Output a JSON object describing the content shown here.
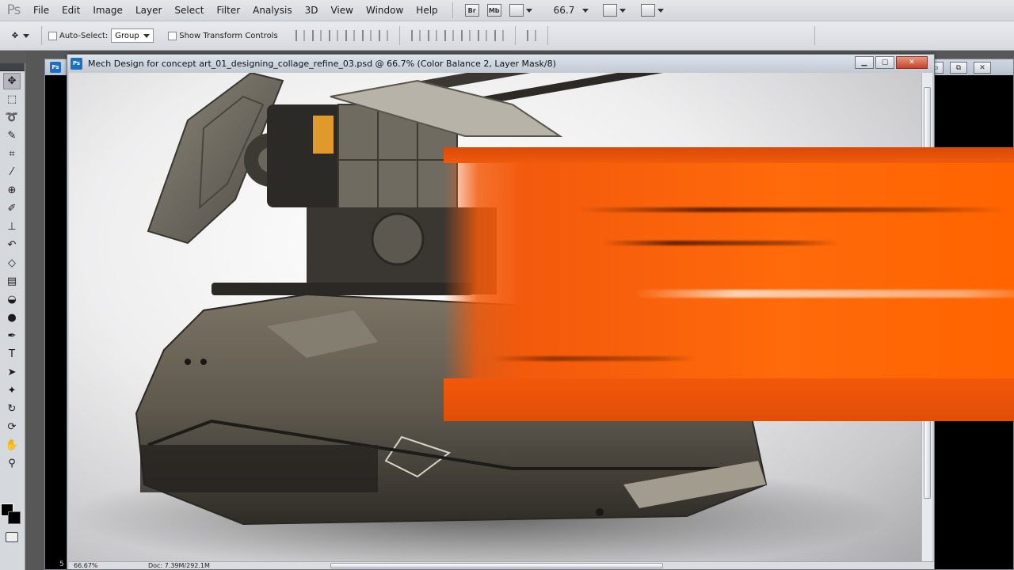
{
  "app": {
    "logo": "Ps",
    "menu": [
      "File",
      "Edit",
      "Image",
      "Layer",
      "Select",
      "Filter",
      "Analysis",
      "3D",
      "View",
      "Window",
      "Help"
    ],
    "bridge_label": "Br",
    "mini_bridge_label": "Mb",
    "zoom_value": "66.7"
  },
  "options": {
    "auto_select_label": "Auto-Select:",
    "auto_select_value": "Group",
    "show_transform_label": "Show Transform Controls"
  },
  "document": {
    "title": "Mech Design for concept art_01_designing_collage_refine_03.psd @ 66.7% (Color Balance 2, Layer Mask/8)",
    "status_zoom": "66.67%",
    "status_doc": "Doc: 7.39M/292.1M",
    "back_status_num": "5"
  },
  "colors": {
    "accent_orange": "#ff6a0a",
    "ui_chrome": "#d6d9de"
  },
  "icons": {
    "tools": [
      "move-tool-icon",
      "marquee-tool-icon",
      "lasso-tool-icon",
      "quick-select-tool-icon",
      "crop-tool-icon",
      "eyedropper-tool-icon",
      "healing-brush-icon",
      "brush-tool-icon",
      "clone-stamp-icon",
      "history-brush-icon",
      "eraser-tool-icon",
      "gradient-tool-icon",
      "blur-tool-icon",
      "dodge-tool-icon",
      "pen-tool-icon",
      "type-tool-icon",
      "path-select-icon",
      "shape-tool-icon",
      "3d-rotate-icon",
      "3d-orbit-icon",
      "hand-tool-icon",
      "zoom-tool-icon"
    ]
  }
}
